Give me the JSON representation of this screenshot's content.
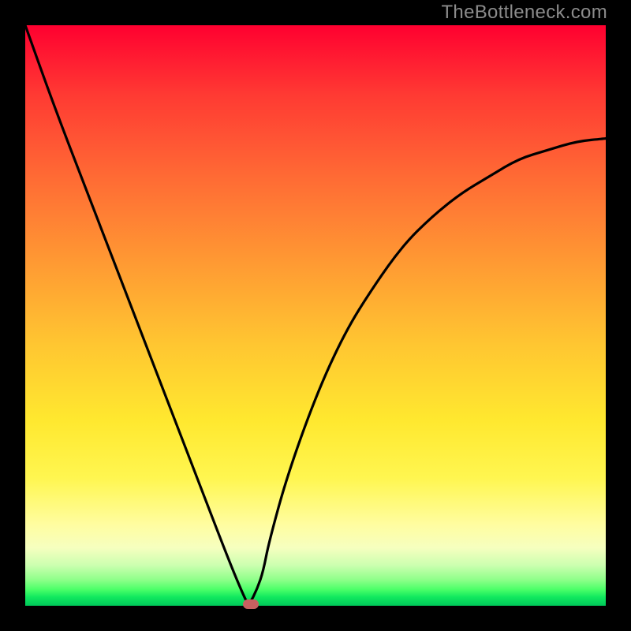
{
  "watermark": "TheBottleneck.com",
  "colors": {
    "frame": "#000000",
    "curve": "#000000",
    "marker": "#c76060",
    "gradient_top": "#ff0030",
    "gradient_bottom": "#00c95a"
  },
  "chart_data": {
    "type": "line",
    "title": "",
    "xlabel": "",
    "ylabel": "",
    "xlim": [
      0,
      100
    ],
    "ylim": [
      0,
      100
    ],
    "x": [
      0,
      5,
      10,
      15,
      20,
      25,
      30,
      35,
      37.5,
      38.5,
      40,
      41,
      42,
      45,
      50,
      55,
      60,
      65,
      70,
      75,
      80,
      85,
      90,
      95,
      100
    ],
    "values": [
      100,
      86,
      73,
      60,
      47,
      34,
      21,
      8,
      2,
      0,
      3,
      6,
      11,
      22,
      36,
      47,
      55,
      62,
      67,
      71,
      74,
      77,
      78.5,
      80,
      80.5
    ],
    "marker": {
      "x": 38.8,
      "y": 0
    }
  }
}
